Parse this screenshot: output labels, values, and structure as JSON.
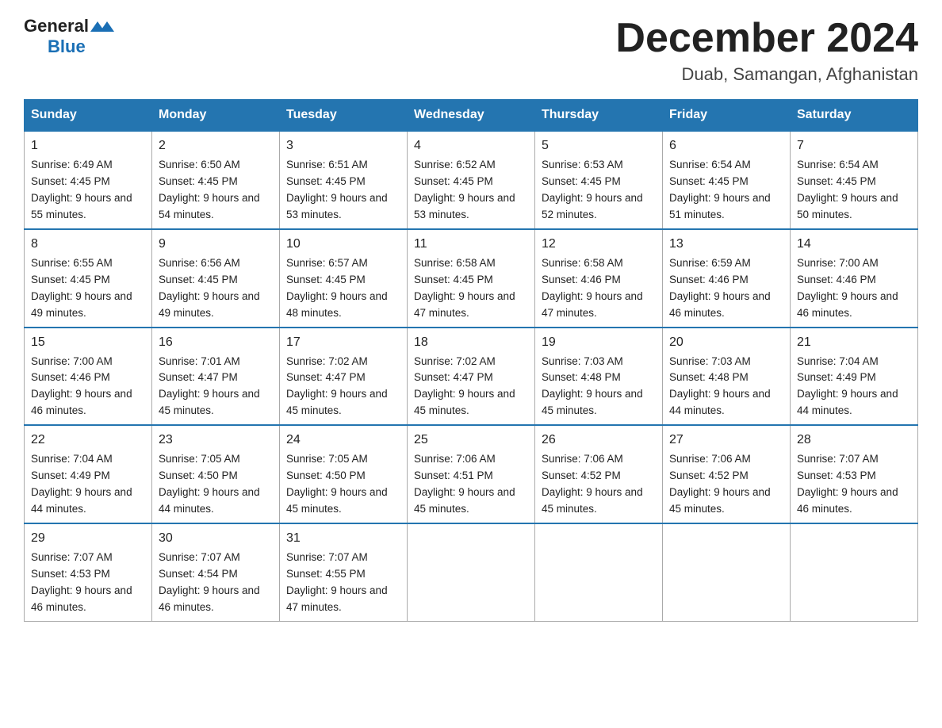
{
  "logo": {
    "general": "General",
    "blue": "Blue"
  },
  "title": "December 2024",
  "location": "Duab, Samangan, Afghanistan",
  "days_of_week": [
    "Sunday",
    "Monday",
    "Tuesday",
    "Wednesday",
    "Thursday",
    "Friday",
    "Saturday"
  ],
  "weeks": [
    [
      {
        "day": "1",
        "sunrise": "6:49 AM",
        "sunset": "4:45 PM",
        "daylight": "9 hours and 55 minutes."
      },
      {
        "day": "2",
        "sunrise": "6:50 AM",
        "sunset": "4:45 PM",
        "daylight": "9 hours and 54 minutes."
      },
      {
        "day": "3",
        "sunrise": "6:51 AM",
        "sunset": "4:45 PM",
        "daylight": "9 hours and 53 minutes."
      },
      {
        "day": "4",
        "sunrise": "6:52 AM",
        "sunset": "4:45 PM",
        "daylight": "9 hours and 53 minutes."
      },
      {
        "day": "5",
        "sunrise": "6:53 AM",
        "sunset": "4:45 PM",
        "daylight": "9 hours and 52 minutes."
      },
      {
        "day": "6",
        "sunrise": "6:54 AM",
        "sunset": "4:45 PM",
        "daylight": "9 hours and 51 minutes."
      },
      {
        "day": "7",
        "sunrise": "6:54 AM",
        "sunset": "4:45 PM",
        "daylight": "9 hours and 50 minutes."
      }
    ],
    [
      {
        "day": "8",
        "sunrise": "6:55 AM",
        "sunset": "4:45 PM",
        "daylight": "9 hours and 49 minutes."
      },
      {
        "day": "9",
        "sunrise": "6:56 AM",
        "sunset": "4:45 PM",
        "daylight": "9 hours and 49 minutes."
      },
      {
        "day": "10",
        "sunrise": "6:57 AM",
        "sunset": "4:45 PM",
        "daylight": "9 hours and 48 minutes."
      },
      {
        "day": "11",
        "sunrise": "6:58 AM",
        "sunset": "4:45 PM",
        "daylight": "9 hours and 47 minutes."
      },
      {
        "day": "12",
        "sunrise": "6:58 AM",
        "sunset": "4:46 PM",
        "daylight": "9 hours and 47 minutes."
      },
      {
        "day": "13",
        "sunrise": "6:59 AM",
        "sunset": "4:46 PM",
        "daylight": "9 hours and 46 minutes."
      },
      {
        "day": "14",
        "sunrise": "7:00 AM",
        "sunset": "4:46 PM",
        "daylight": "9 hours and 46 minutes."
      }
    ],
    [
      {
        "day": "15",
        "sunrise": "7:00 AM",
        "sunset": "4:46 PM",
        "daylight": "9 hours and 46 minutes."
      },
      {
        "day": "16",
        "sunrise": "7:01 AM",
        "sunset": "4:47 PM",
        "daylight": "9 hours and 45 minutes."
      },
      {
        "day": "17",
        "sunrise": "7:02 AM",
        "sunset": "4:47 PM",
        "daylight": "9 hours and 45 minutes."
      },
      {
        "day": "18",
        "sunrise": "7:02 AM",
        "sunset": "4:47 PM",
        "daylight": "9 hours and 45 minutes."
      },
      {
        "day": "19",
        "sunrise": "7:03 AM",
        "sunset": "4:48 PM",
        "daylight": "9 hours and 45 minutes."
      },
      {
        "day": "20",
        "sunrise": "7:03 AM",
        "sunset": "4:48 PM",
        "daylight": "9 hours and 44 minutes."
      },
      {
        "day": "21",
        "sunrise": "7:04 AM",
        "sunset": "4:49 PM",
        "daylight": "9 hours and 44 minutes."
      }
    ],
    [
      {
        "day": "22",
        "sunrise": "7:04 AM",
        "sunset": "4:49 PM",
        "daylight": "9 hours and 44 minutes."
      },
      {
        "day": "23",
        "sunrise": "7:05 AM",
        "sunset": "4:50 PM",
        "daylight": "9 hours and 44 minutes."
      },
      {
        "day": "24",
        "sunrise": "7:05 AM",
        "sunset": "4:50 PM",
        "daylight": "9 hours and 45 minutes."
      },
      {
        "day": "25",
        "sunrise": "7:06 AM",
        "sunset": "4:51 PM",
        "daylight": "9 hours and 45 minutes."
      },
      {
        "day": "26",
        "sunrise": "7:06 AM",
        "sunset": "4:52 PM",
        "daylight": "9 hours and 45 minutes."
      },
      {
        "day": "27",
        "sunrise": "7:06 AM",
        "sunset": "4:52 PM",
        "daylight": "9 hours and 45 minutes."
      },
      {
        "day": "28",
        "sunrise": "7:07 AM",
        "sunset": "4:53 PM",
        "daylight": "9 hours and 46 minutes."
      }
    ],
    [
      {
        "day": "29",
        "sunrise": "7:07 AM",
        "sunset": "4:53 PM",
        "daylight": "9 hours and 46 minutes."
      },
      {
        "day": "30",
        "sunrise": "7:07 AM",
        "sunset": "4:54 PM",
        "daylight": "9 hours and 46 minutes."
      },
      {
        "day": "31",
        "sunrise": "7:07 AM",
        "sunset": "4:55 PM",
        "daylight": "9 hours and 47 minutes."
      },
      null,
      null,
      null,
      null
    ]
  ]
}
